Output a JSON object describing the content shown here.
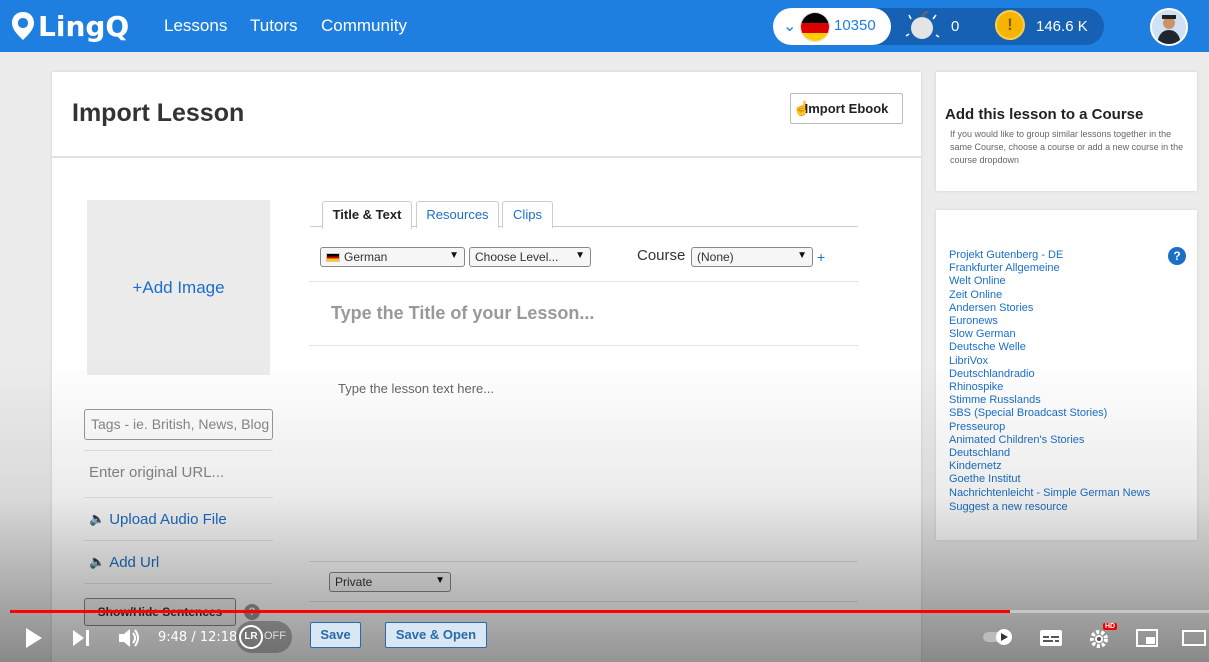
{
  "nav": {
    "logo_text": "LingQ",
    "links": [
      "Lessons",
      "Tutors",
      "Community"
    ],
    "language_count": "10350",
    "known_words": "0",
    "coins": "146.6 K",
    "language_flag_colors": [
      "#000000",
      "#dd0000",
      "#ffce00"
    ]
  },
  "main": {
    "title": "Import Lesson",
    "import_ebook_label": "Import Ebook",
    "add_image_label": "+Add Image",
    "tags_placeholder": "Tags - ie. British, News, Blog",
    "url_placeholder": "Enter original URL...",
    "upload_audio_label": "Upload Audio File",
    "add_url_label": "Add Url",
    "show_hide_label": "Show/Hide Sentences",
    "tabs": [
      "Title & Text",
      "Resources",
      "Clips"
    ],
    "language_select": "German",
    "level_select": "Choose Level...",
    "course_label": "Course",
    "course_select": "(None)",
    "title_placeholder": "Type the Title of your Lesson...",
    "text_placeholder": "Type the lesson text here...",
    "privacy_select": "Private",
    "save_label": "Save",
    "save_open_label": "Save & Open"
  },
  "course_panel": {
    "title": "Add this lesson to a Course",
    "description": "If you would like to group similar lessons together in the same Course, choose a course or add a new course in the course dropdown"
  },
  "resources": {
    "items": [
      "Projekt Gutenberg - DE",
      "Frankfurter Allgemeine",
      "Welt Online",
      "Zeit Online",
      "Andersen Stories",
      "Euronews",
      "Slow German",
      "Deutsche Welle",
      "LibriVox",
      "Deutschlandradio",
      "Rhinospike",
      "Stimme Russlands",
      "SBS (Special Broadcast Stories)",
      "Presseurop",
      "Animated Children's Stories",
      "Deutschland",
      "Kindernetz",
      "Goethe Institut",
      "Nachrichtenleicht - Simple German News"
    ],
    "suggest_label": "Suggest a new resource"
  },
  "player": {
    "time": "9:48 / 12:18",
    "progress": 0.834,
    "toggle_label": "OFF",
    "lr_badge": "LR",
    "hd_badge": "HD",
    "accent_color": "#ff0000"
  }
}
